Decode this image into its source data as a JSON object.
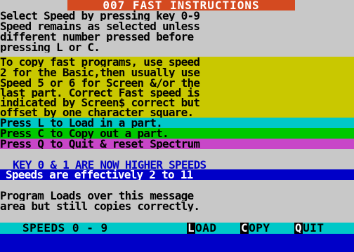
{
  "title": "007 FAST INSTRUCTIONS",
  "intro_lines": [
    "Select Speed by pressing key 0-9",
    "Speed remains as selected unless",
    "different number pressed before",
    "pressing L or C."
  ],
  "copy_lines": [
    "To copy fast programs, use speed",
    "2 for the Basic,then usually use",
    "Speed 5 or 6 for Screen &/or the",
    "last part. Correct Fast speed is",
    "indicated by Screen$ correct but",
    "offset by one character square."
  ],
  "key_lines": {
    "load": "Press L to Load in a part.",
    "copy": "Press C to Copy out a part.",
    "quit": "Press Q to Quit & reset Spectrum"
  },
  "notice": {
    "line1": "KEY 0 & 1 ARE NOW HIGHER SPEEDS",
    "line2": "Speeds are effectively 2 to 11"
  },
  "program_lines": [
    "Program Loads over this message",
    "area but still copies correctly."
  ],
  "menu": {
    "speeds": "SPEEDS 0 - 9",
    "load_key": "L",
    "load_rest": "OAD",
    "copy_key": "C",
    "copy_rest": "OPY",
    "quit_key": "Q",
    "quit_rest": "UIT"
  },
  "colors": {
    "background": "#c8c8c8",
    "title_bg": "#d44a20",
    "yellow": "#c9c800",
    "cyan": "#00c8c8",
    "green": "#00c800",
    "magenta": "#c846c8",
    "blue": "#0000c8"
  }
}
